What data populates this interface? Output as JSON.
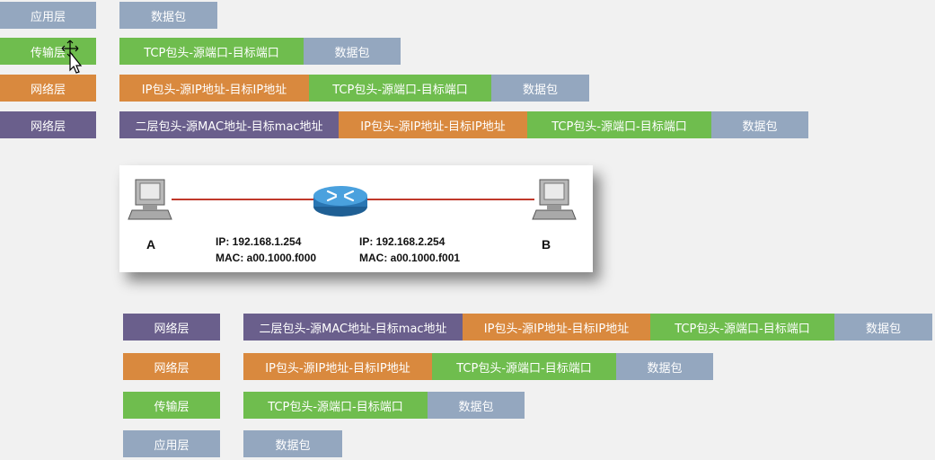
{
  "top_stack": {
    "layer_labels": [
      "应用层",
      "传输层",
      "网络层",
      "网络层"
    ],
    "rows": [
      [
        "数据包"
      ],
      [
        "TCP包头-源端口-目标端口",
        "数据包"
      ],
      [
        "IP包头-源IP地址-目标IP地址",
        "TCP包头-源端口-目标端口",
        "数据包"
      ],
      [
        "二层包头-源MAC地址-目标mac地址",
        "IP包头-源IP地址-目标IP地址",
        "TCP包头-源端口-目标端口",
        "数据包"
      ]
    ]
  },
  "bottom_stack": {
    "layer_labels": [
      "网络层",
      "网络层",
      "传输层",
      "应用层"
    ],
    "rows": [
      [
        "二层包头-源MAC地址-目标mac地址",
        "IP包头-源IP地址-目标IP地址",
        "TCP包头-源端口-目标端口",
        "数据包"
      ],
      [
        "IP包头-源IP地址-目标IP地址",
        "TCP包头-源端口-目标端口",
        "数据包"
      ],
      [
        "TCP包头-源端口-目标端口",
        "数据包"
      ],
      [
        "数据包"
      ]
    ]
  },
  "network": {
    "host_a": "A",
    "host_b": "B",
    "left_port": {
      "ip": "IP: 192.168.1.254",
      "mac": "MAC: a00.1000.f000"
    },
    "right_port": {
      "ip": "IP: 192.168.2.254",
      "mac": "MAC: a00.1000.f001"
    }
  },
  "colors": {
    "app": "#94a7bf",
    "transport": "#6fbd4e",
    "network_orange": "#d9893e",
    "network_purple": "#6a5f8c",
    "link": "#c0392b",
    "router": "#2f86c8"
  },
  "icons": [
    "computer-icon",
    "router-icon",
    "cursor-icon"
  ]
}
